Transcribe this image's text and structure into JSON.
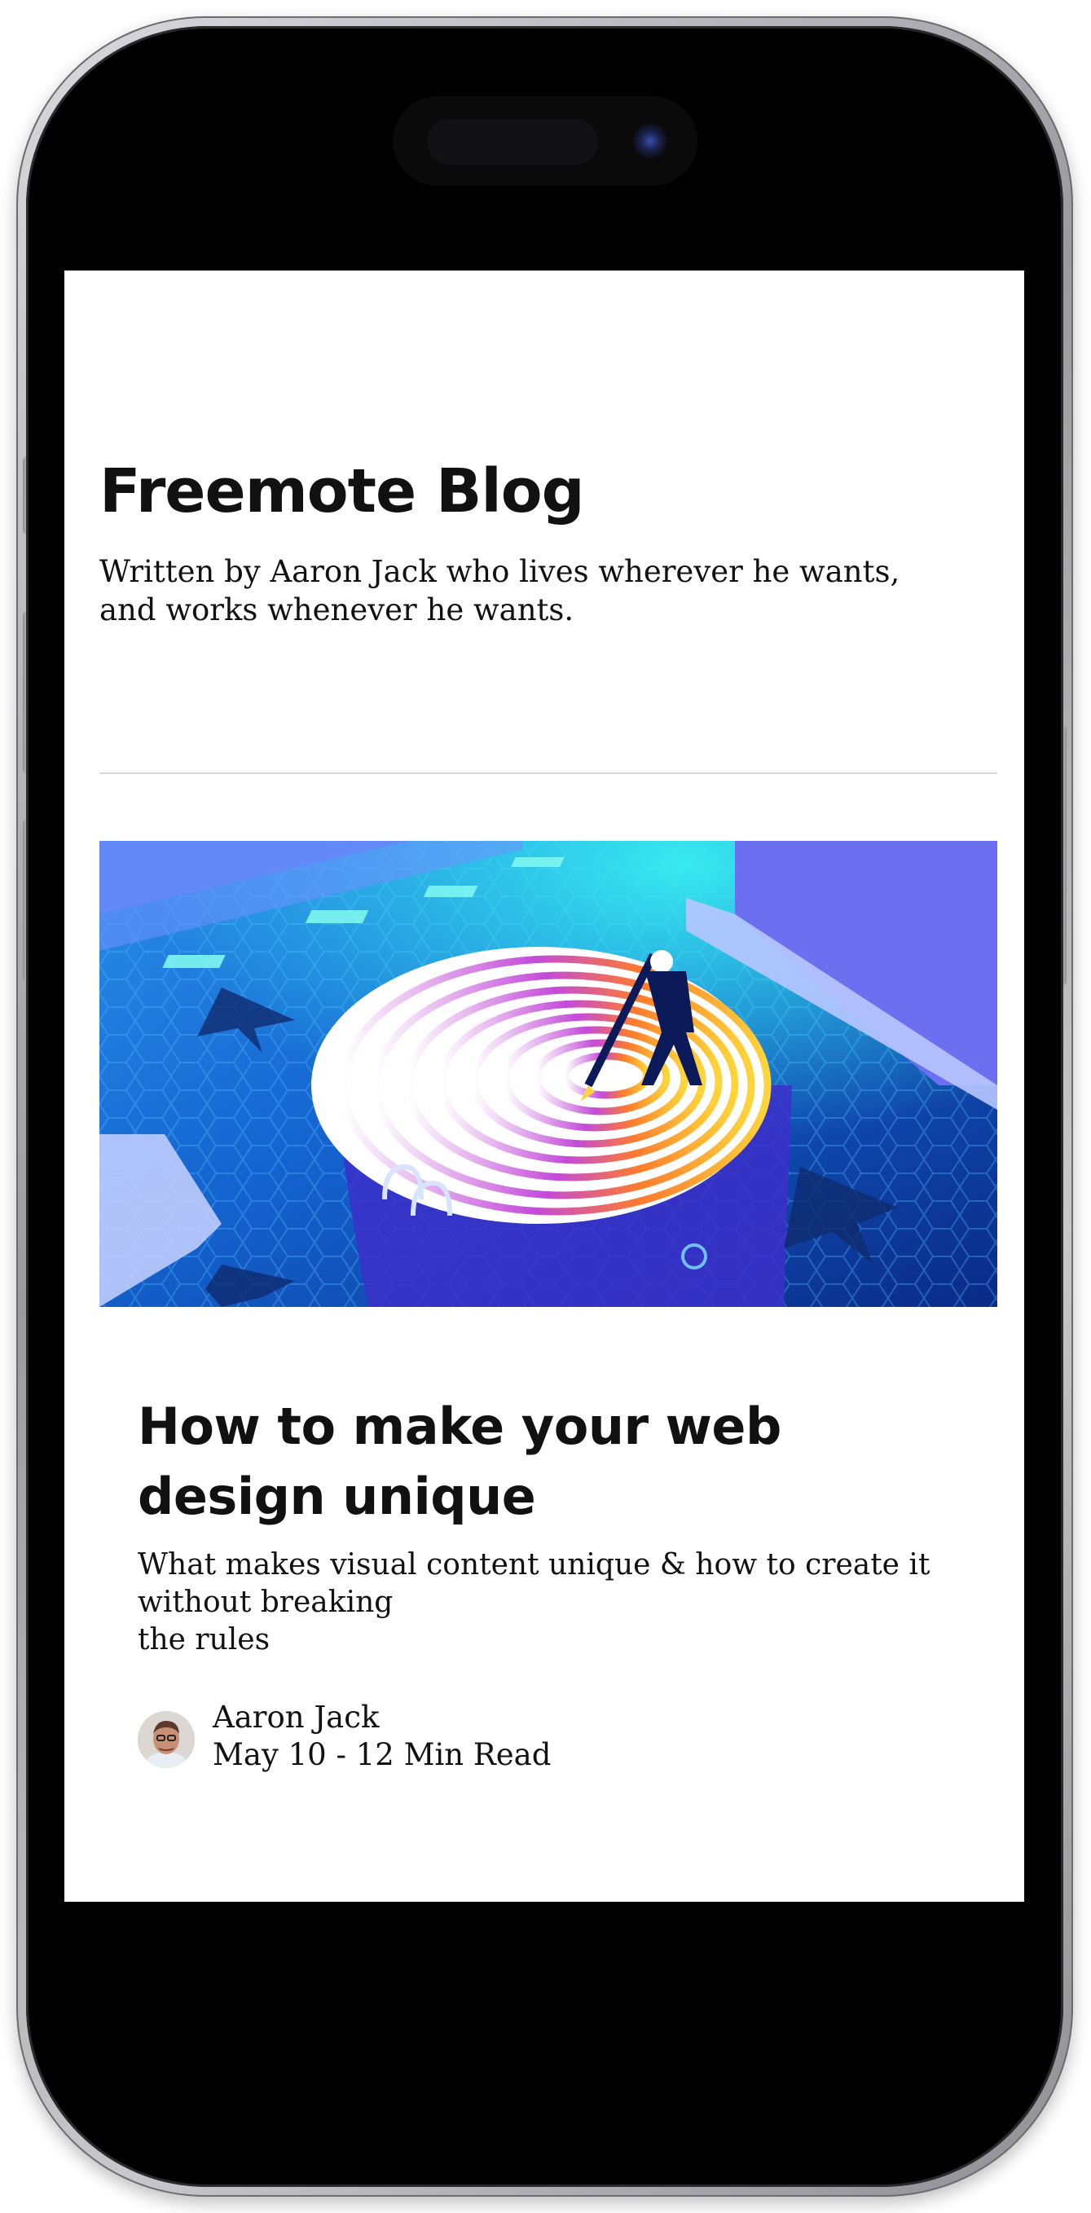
{
  "blog": {
    "title": "Freemote Blog",
    "subtitle": "Written by Aaron Jack who lives wherever he wants, and works whenever he wants."
  },
  "post": {
    "title": "How to make your web design unique",
    "description_lines": [
      "What makes visual content unique & how to create it",
      "without breaking",
      "the rules"
    ],
    "author": "Aaron Jack",
    "date": "May 10",
    "separator": "-",
    "read_time": "12 Min Read"
  },
  "colors": {
    "text": "#111111",
    "divider": "#d6d6d6",
    "hero_water": "#1a66d6"
  },
  "icons": {
    "camera": "front-camera-icon",
    "avatar": "author-avatar"
  }
}
